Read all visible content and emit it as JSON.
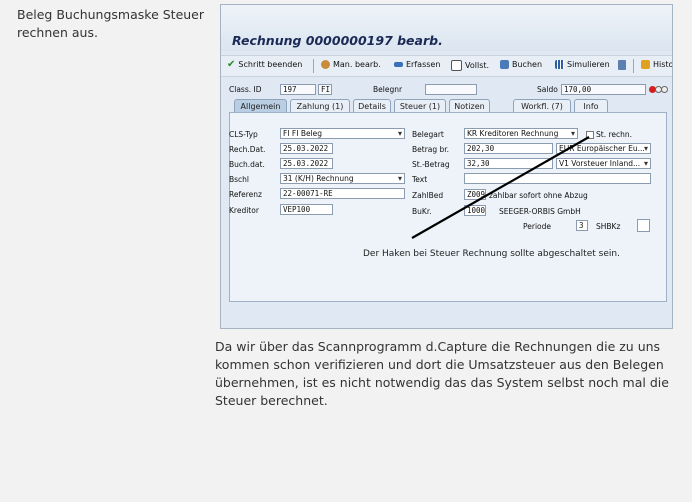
{
  "notes": {
    "top": "Beleg Buchungsmaske Steuer rechnen aus.",
    "bottom": "Da wir über das Scannprogramm d.Capture die Rechnungen die zu uns kommen schon verifizieren und dort die Umsatzsteuer aus den Belegen übernehmen, ist es nicht notwendig das das System selbst noch mal die Steuer berechnet."
  },
  "window": {
    "title": "Rechnung 0000000197 bearb."
  },
  "toolbar": {
    "schritt": "Schritt beenden",
    "man": "Man. bearb.",
    "erfassen": "Erfassen",
    "vollst": "Vollst.",
    "buchen": "Buchen",
    "simulieren": "Simulieren",
    "histo": "Histo"
  },
  "header": {
    "class_label": "Class. ID",
    "class_value": "197",
    "class_type": "FI",
    "belegnr_label": "Belegnr",
    "belegnr_value": "",
    "saldo_label": "Saldo",
    "saldo_value": "170,00"
  },
  "tabs": [
    "Allgemein",
    "Zahlung (1)",
    "Details",
    "Steuer (1)",
    "Notizen",
    "Workfl. (7)",
    "Info"
  ],
  "form": {
    "cls_typ_label": "CLS-Typ",
    "cls_typ_value": "FI FI Beleg",
    "rech_dat_label": "Rech.Dat.",
    "rech_dat_value": "25.03.2022",
    "buch_dat_label": "Buch.dat.",
    "buch_dat_value": "25.03.2022",
    "bschl_label": "Bschl",
    "bschl_value": "31 (K/H) Rechnung",
    "referenz_label": "Referenz",
    "referenz_value": "22-00071-RE",
    "kreditor_label": "Kreditor",
    "kreditor_value": "VEP100",
    "belegart_label": "Belegart",
    "belegart_value": "KR Kreditoren Rechnung",
    "st_rechn_label": "St. rechn.",
    "betrag_label": "Betrag br.",
    "betrag_value": "202,30",
    "currency_value": "EUR Europäischer Eu...",
    "st_betrag_label": "St.-Betrag",
    "st_betrag_value": "32,30",
    "tax_code_value": "V1 Vorsteuer Inland...",
    "text_label": "Text",
    "text_value": "",
    "zahlbed_label": "ZahlBed",
    "zahlbed_value": "Z009",
    "zahlbed_desc": "zahlbar sofort ohne Abzug",
    "bukr_label": "BuKr.",
    "bukr_value": "1000",
    "bukr_desc": "SEEGER-ORBIS GmbH",
    "periode_label": "Periode",
    "periode_value": "3",
    "shbkz_label": "SHBKz",
    "shbkz_value": ""
  },
  "annotation": "Der Haken bei Steuer Rechnung sollte abgeschaltet sein.",
  "colors": {
    "background": "#f2f2f2",
    "sap_panel": "#dfe8f3",
    "title": "#1a2a55",
    "arrow": "#000000"
  }
}
